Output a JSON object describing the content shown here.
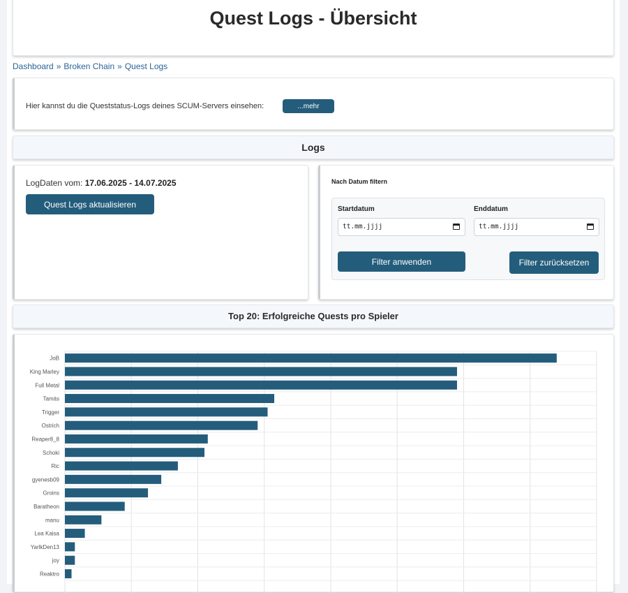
{
  "header": {
    "title": "Quest Logs - Übersicht"
  },
  "breadcrumb": {
    "items": [
      "Dashboard",
      "Broken Chain",
      "Quest Logs"
    ],
    "separator": "»"
  },
  "info": {
    "text": "Hier kannst du die Queststatus-Logs deines SCUM-Servers einsehen:",
    "more_label": "...mehr"
  },
  "logs_section": {
    "title": "Logs"
  },
  "log_info": {
    "label": "LogDaten vom:",
    "range": "17.06.2025 - 14.07.2025",
    "update_label": "Quest Logs aktualisieren"
  },
  "filter": {
    "title": "Nach Datum filtern",
    "start_label": "Startdatum",
    "end_label": "Enddatum",
    "start_placeholder": "tt.mm.jjjj",
    "end_placeholder": "tt.mm.jjjj",
    "apply_label": "Filter anwenden",
    "reset_label": "Filter zurücksetzen"
  },
  "chart_section": {
    "title": "Top 20: Erfolgreiche Quests pro Spieler"
  },
  "colors": {
    "accent": "#245d7c",
    "bar": "#245d7c"
  },
  "chart_data": {
    "type": "bar",
    "orientation": "horizontal",
    "categories": [
      "JoB",
      "King Marley",
      "Full Metal",
      "Tamás",
      "Trigger",
      "Ostrich",
      "Reaper8_8",
      "Schoki",
      "Ric",
      "gyenesb09",
      "Groins",
      "Baratheon",
      "manu",
      "Lea Kaisa",
      "YarlkDen13",
      "joy",
      "Reaktro"
    ],
    "values": [
      74,
      59,
      59,
      31.5,
      30.5,
      29,
      21.5,
      21,
      17,
      14.5,
      12.5,
      9,
      5.5,
      3,
      1.5,
      1.5,
      1
    ],
    "xlim": [
      0,
      80
    ],
    "grid": true
  }
}
